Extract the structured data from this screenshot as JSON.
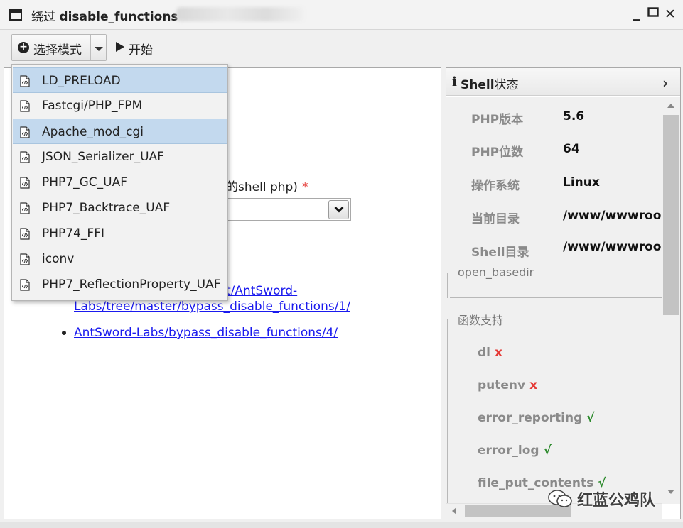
{
  "window": {
    "title_prefix": "绕过 ",
    "title_bold": "disable_functions",
    "minimize": "_",
    "maximize": "□",
    "close": "✕"
  },
  "toolbar": {
    "mode_label": "选择模式",
    "start_label": "开始"
  },
  "menu": {
    "items": [
      {
        "label": "LD_PRELOAD",
        "state": "selected"
      },
      {
        "label": "Fastcgi/PHP_FPM",
        "state": "normal"
      },
      {
        "label": "Apache_mod_cgi",
        "state": "hover"
      },
      {
        "label": "JSON_Serializer_UAF",
        "state": "normal"
      },
      {
        "label": "PHP7_GC_UAF",
        "state": "normal"
      },
      {
        "label": "PHP7_Backtrace_UAF",
        "state": "normal"
      },
      {
        "label": "PHP74_FFI",
        "state": "normal"
      },
      {
        "label": "iconv",
        "state": "normal"
      },
      {
        "label": "PHP7_ReflectionProperty_UAF",
        "state": "normal"
      }
    ]
  },
  "main": {
    "form_label_partial": "的shell php)",
    "required_mark": "*",
    "link1_line1_partial": "t/AntSword-",
    "link1_line2": "Labs/tree/master/bypass_disable_functions/1/",
    "link2": "AntSword-Labs/bypass_disable_functions/4/"
  },
  "side": {
    "info_icon": "i",
    "title_bold": "Shell",
    "title_rest": "状态",
    "rows": [
      {
        "key": "PHP版本",
        "value": "5.6"
      },
      {
        "key": "PHP位数",
        "value": "64"
      },
      {
        "key": "操作系统",
        "value": "Linux"
      },
      {
        "key": "当前目录",
        "value": "/www/wwwroo"
      },
      {
        "key": "Shell目录",
        "value": "/www/wwwroo"
      }
    ],
    "open_basedir_legend": "open_basedir",
    "func_legend": "函数支持",
    "functions": [
      {
        "name": "dl",
        "status": "x"
      },
      {
        "name": "putenv",
        "status": "x"
      },
      {
        "name": "error_reporting",
        "status": "√"
      },
      {
        "name": "error_log",
        "status": "√"
      },
      {
        "name": "file_put_contents",
        "status": "√"
      }
    ]
  },
  "watermark": {
    "text": "红蓝公鸡队"
  },
  "colors": {
    "selection": "#c3d9ee",
    "link": "#1a1aee",
    "bad": "#e53935",
    "good": "#2e8b2e"
  }
}
